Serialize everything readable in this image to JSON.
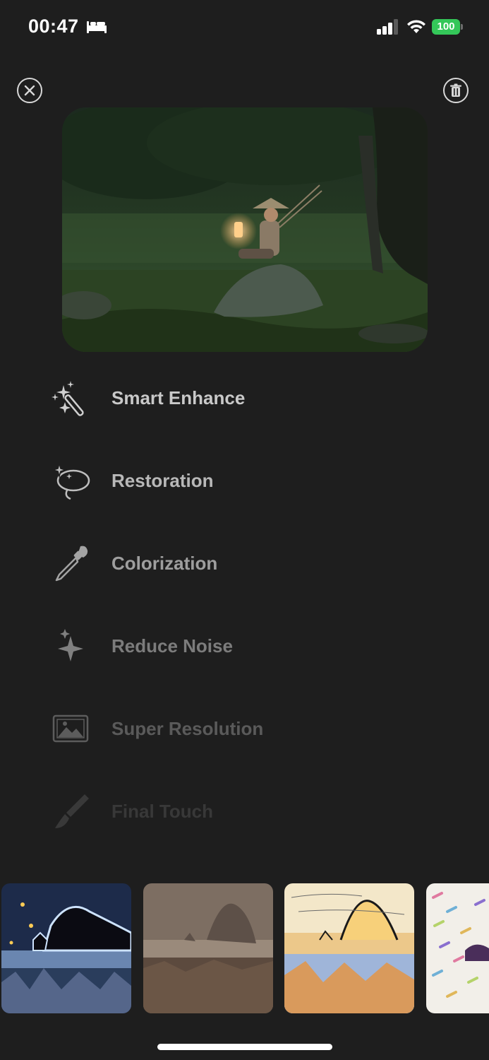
{
  "status_bar": {
    "time": "00:47",
    "battery": "100",
    "icons": [
      "bed-icon",
      "signal-icon",
      "wifi-icon",
      "battery-icon"
    ]
  },
  "header": {
    "close_icon": "close-icon",
    "delete_icon": "trash-icon"
  },
  "tools": [
    {
      "label": "Smart Enhance",
      "icon": "magic-wand-icon",
      "opacity": 1.0
    },
    {
      "label": "Restoration",
      "icon": "lasso-sparkle-icon",
      "opacity": 0.9
    },
    {
      "label": "Colorization",
      "icon": "eyedropper-icon",
      "opacity": 0.75
    },
    {
      "label": "Reduce Noise",
      "icon": "sparkles-icon",
      "opacity": 0.55
    },
    {
      "label": "Super Resolution",
      "icon": "image-icon",
      "opacity": 0.35
    },
    {
      "label": "Final Touch",
      "icon": "brush-icon",
      "opacity": 0.15
    }
  ],
  "styles": [
    "night-style-thumbnail",
    "sepia-style-thumbnail",
    "sketch-style-thumbnail",
    "mosaic-style-thumbnail"
  ],
  "colors": {
    "background": "#1e1e1e",
    "battery": "#34c759",
    "text": "#c9c9c9"
  }
}
